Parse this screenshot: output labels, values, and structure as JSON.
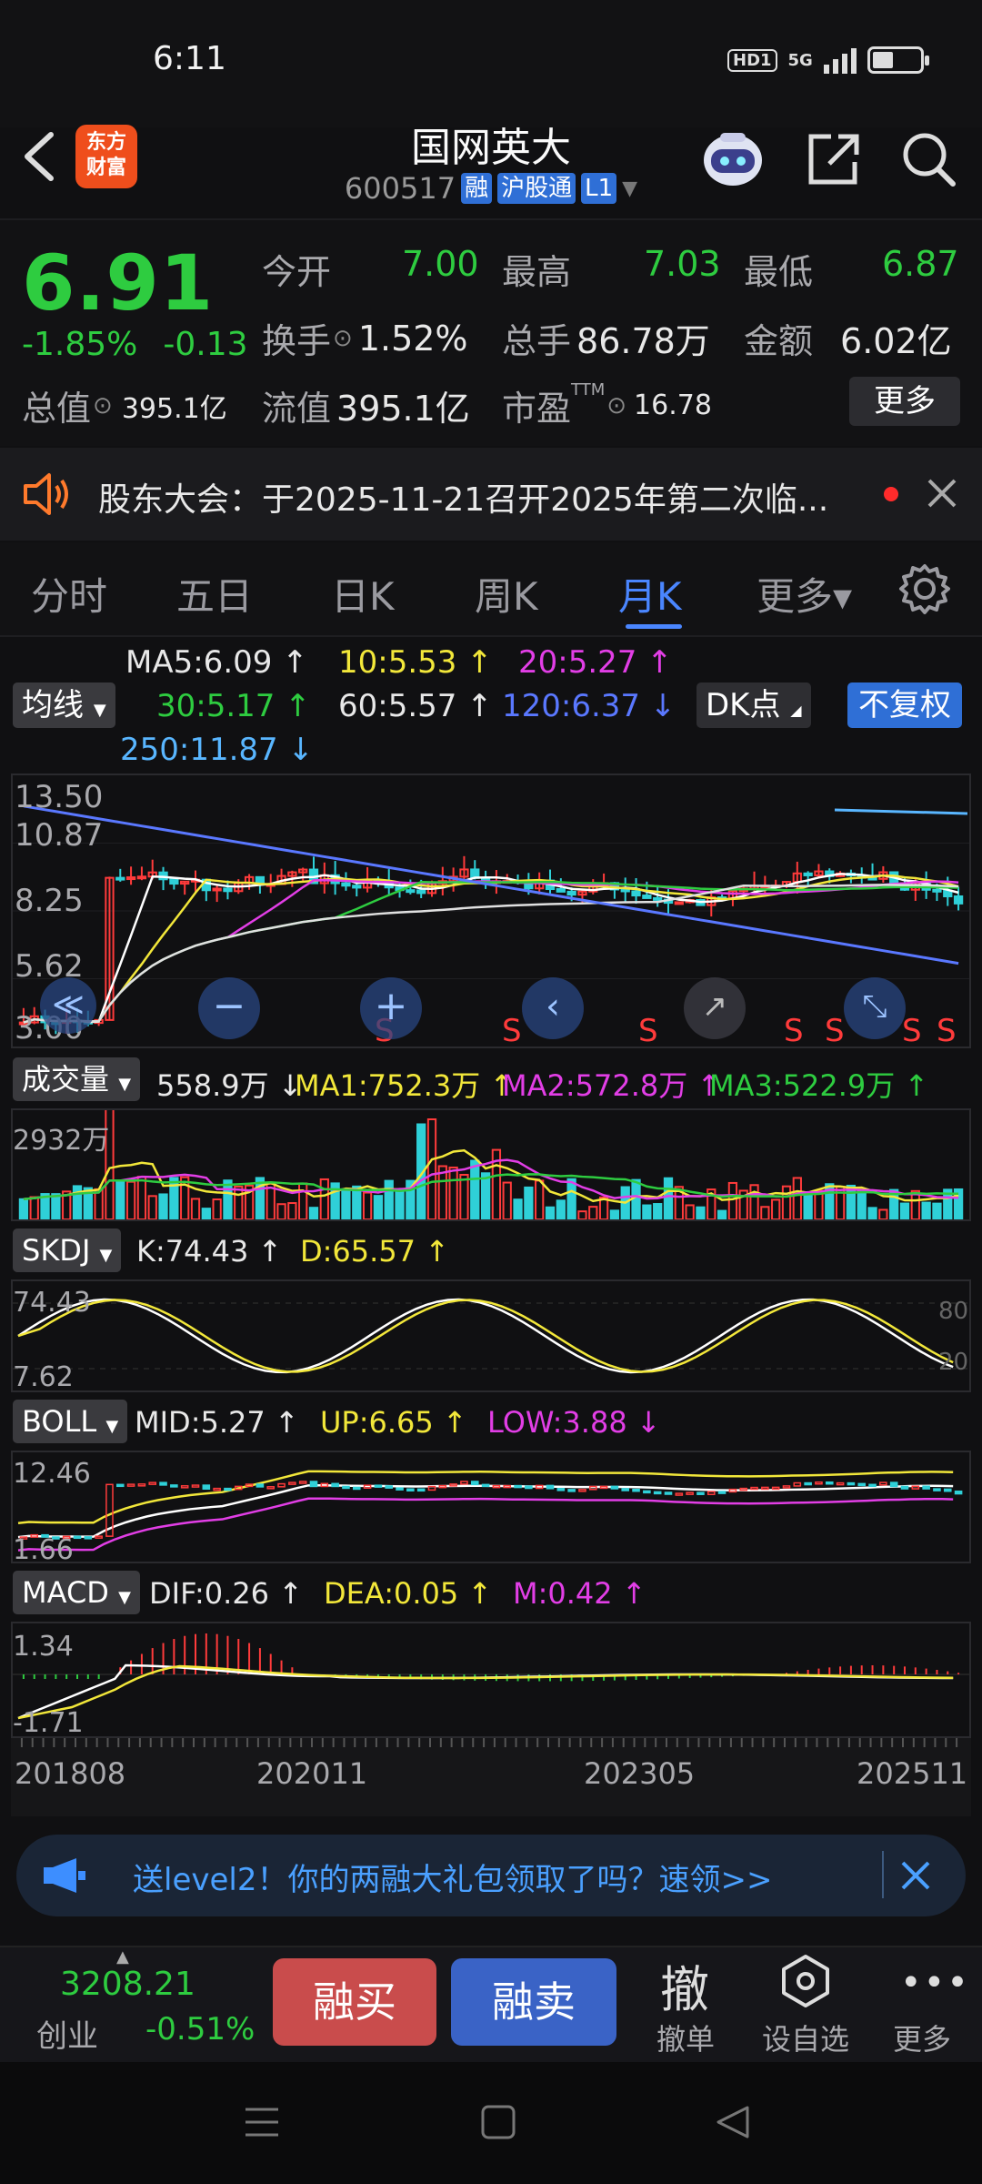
{
  "status_bar": {
    "time": "6:11",
    "hd": "HD1",
    "network": "5G"
  },
  "header": {
    "logo_text": [
      "东方",
      "财富"
    ],
    "stock_name": "国网英大",
    "stock_code": "600517",
    "tags": [
      "融",
      "沪股通",
      "L1"
    ]
  },
  "quote": {
    "price": "6.91",
    "change_pct": "-1.85%",
    "change_abs": "-0.13",
    "open_label": "今开",
    "open_value": "7.00",
    "high_label": "最高",
    "high_value": "7.03",
    "low_label": "最低",
    "low_value": "6.87",
    "turnover_label": "换手",
    "turnover_value": "1.52%",
    "volume_label": "总手",
    "volume_value": "86.78万",
    "amount_label": "金额",
    "amount_value": "6.02亿",
    "mktcap_label": "总值",
    "mktcap_value": "395.1亿",
    "float_label": "流值",
    "float_value": "395.1亿",
    "pe_label": "市盈",
    "pe_sup": "TTM",
    "pe_value": "16.78",
    "more_label": "更多"
  },
  "notice": {
    "text": "股东大会：于2025-11-21召开2025年第二次临..."
  },
  "tabs": [
    {
      "label": "分时"
    },
    {
      "label": "五日"
    },
    {
      "label": "日K"
    },
    {
      "label": "周K"
    },
    {
      "label": "月K"
    },
    {
      "label": "更多▾"
    }
  ],
  "active_tab": "月K",
  "ma_legend": {
    "selector": "均线",
    "ma5": "MA5:6.09",
    "ma10": "10:5.53",
    "ma20": "20:5.27",
    "ma30": "30:5.17",
    "ma60": "60:5.57",
    "ma120": "120:6.37",
    "ma250": "250:11.87",
    "dk_button": "DK点",
    "fq_button": "不复权"
  },
  "kline": {
    "y_labels": [
      "13.50",
      "10.87",
      "8.25",
      "5.62",
      "3.00"
    ],
    "signal_label": "S",
    "signals_count": 8
  },
  "volume": {
    "selector": "成交量",
    "value": "558.9万",
    "ma1": "MA1:752.3万",
    "ma2": "MA2:572.8万",
    "ma3": "MA3:522.9万",
    "y_label": "2932万"
  },
  "skdj": {
    "selector": "SKDJ",
    "k": "K:74.43",
    "d": "D:65.57",
    "y_top": "74.43",
    "y_bottom": "7.62",
    "right_80": "80",
    "right_20": "20"
  },
  "boll": {
    "selector": "BOLL",
    "mid": "MID:5.27",
    "up": "UP:6.65",
    "low": "LOW:3.88",
    "y_top": "12.46",
    "y_bottom": "1.66"
  },
  "macd": {
    "selector": "MACD",
    "dif": "DIF:0.26",
    "dea": "DEA:0.05",
    "m": "M:0.42",
    "y_top": "1.34",
    "y_bottom": "-1.71"
  },
  "x_axis": [
    "201808",
    "202011",
    "202305",
    "202511"
  ],
  "promo": {
    "text": "送level2！你的两融大礼包领取了吗？速领>>"
  },
  "bottom_bar": {
    "index_value": "3208.21",
    "index_name": "创业",
    "index_change": "-0.51%",
    "buy_label": "融买",
    "sell_label": "融卖",
    "cancel_icon_text": "撤",
    "cancel_label": "撤单",
    "watch_label": "设自选",
    "more_label": "更多"
  },
  "colors": {
    "down": "#2ecc40",
    "up": "#ff3b3b",
    "accent": "#4a86ff",
    "ma5": "#ffffff",
    "ma10": "#f2e73a",
    "ma20": "#e23ee6",
    "ma30": "#2ecc40",
    "ma60": "#ffffff",
    "ma120": "#5a78ff",
    "ma250": "#59b6ff"
  }
}
